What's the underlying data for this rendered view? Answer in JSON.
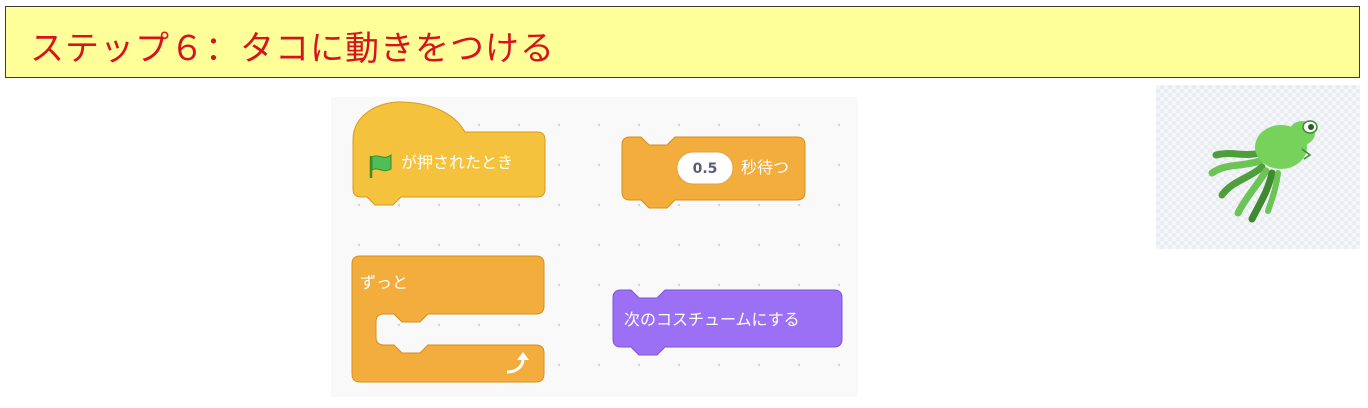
{
  "title": "ステップ６：タコに動きをつける",
  "blocks": {
    "when_flag": {
      "label": "が押されたとき",
      "icon": "green-flag-icon",
      "color": "#ffbf00"
    },
    "wait": {
      "value": "0.5",
      "label": "秒待つ",
      "color": "#ffab19"
    },
    "forever": {
      "label": "ずっと",
      "icon": "loop-arrow-icon",
      "color": "#ffab19"
    },
    "next_costume": {
      "label": "次のコスチュームにする",
      "color": "#9966ff"
    }
  },
  "sprite": {
    "name": "octopus",
    "color": "#77d25b"
  }
}
